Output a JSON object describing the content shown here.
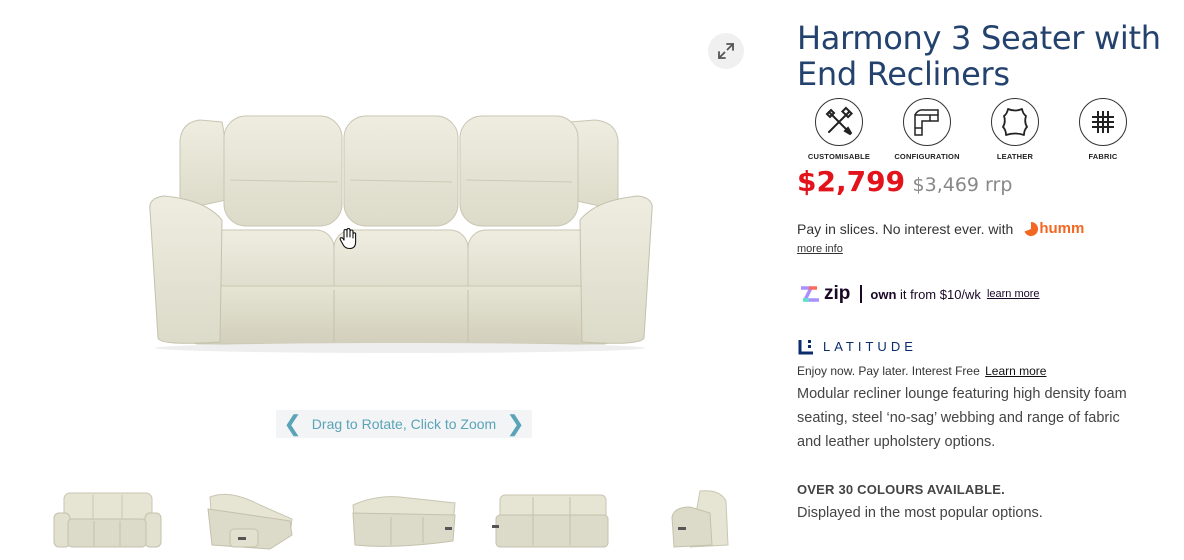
{
  "viewer": {
    "rotate_hint": "Drag to Rotate, Click to Zoom",
    "prev_glyph": "❮",
    "next_glyph": "❯",
    "expand_icon": "expand-icon",
    "cursor_icon": "hand-cursor-icon",
    "thumbnails": [
      {
        "label": "sofa-front"
      },
      {
        "label": "sofa-angle-left"
      },
      {
        "label": "sofa-back-angle"
      },
      {
        "label": "sofa-back"
      },
      {
        "label": "sofa-side"
      }
    ]
  },
  "product": {
    "title": "Harmony 3 Seater with End Recliners",
    "features": [
      {
        "label": "CUSTOMISABLE",
        "icon": "tools-icon"
      },
      {
        "label": "CONFIGURATION",
        "icon": "corner-sofa-icon"
      },
      {
        "label": "LEATHER",
        "icon": "leather-hide-icon"
      },
      {
        "label": "FABRIC",
        "icon": "fabric-weave-icon"
      }
    ],
    "price": "$2,799",
    "rrp": "$3,469 rrp",
    "humm": {
      "text": "Pay in slices. No interest ever. with",
      "logo": "humm",
      "more_info": "more info"
    },
    "zip": {
      "logo": "zip",
      "own_bold": "own",
      "own_rest": "it from $10/wk",
      "learn_more": "learn more"
    },
    "latitude": {
      "logo": "LATITUDE",
      "line": "Enjoy now. Pay later. Interest Free",
      "learn_more": "Learn more"
    },
    "description": "Modular recliner lounge featuring high density foam seating, steel ‘no-sag’ webbing and range of fabric and leather upholstery options.",
    "colours_heading": "OVER 30 COLOURS AVAILABLE.",
    "colours_note": "Displayed in the most popular options."
  },
  "colors": {
    "title": "#23426e",
    "price": "#e2131a",
    "rrp": "#888888",
    "humm": "#f26722",
    "latitude": "#0a2d6e",
    "rotate_hint": "#5aa3b8",
    "sofa": "#e8e6d6"
  }
}
